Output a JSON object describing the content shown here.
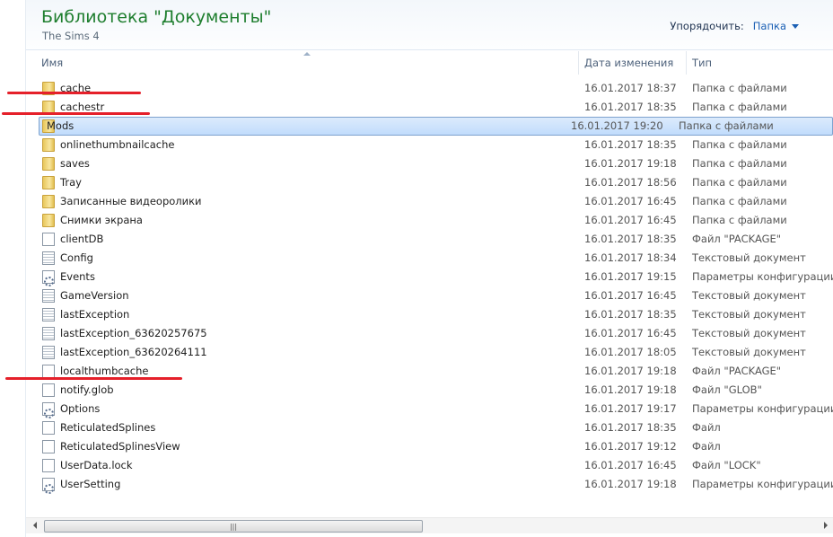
{
  "header": {
    "title": "Библиотека \"Документы\"",
    "subtitle": "The Sims 4",
    "arrange_label": "Упорядочить:",
    "arrange_value": "Папка"
  },
  "columns": {
    "name": "Имя",
    "date": "Дата изменения",
    "type": "Тип"
  },
  "rows": [
    {
      "name": "cache",
      "date": "16.01.2017 18:37",
      "type": "Папка с файлами",
      "icon": "folder"
    },
    {
      "name": "cachestr",
      "date": "16.01.2017 18:35",
      "type": "Папка с файлами",
      "icon": "folder"
    },
    {
      "name": "Mods",
      "date": "16.01.2017 19:20",
      "type": "Папка с файлами",
      "icon": "folder",
      "selected": true
    },
    {
      "name": "onlinethumbnailcache",
      "date": "16.01.2017 18:35",
      "type": "Папка с файлами",
      "icon": "folder"
    },
    {
      "name": "saves",
      "date": "16.01.2017 19:18",
      "type": "Папка с файлами",
      "icon": "folder"
    },
    {
      "name": "Tray",
      "date": "16.01.2017 18:56",
      "type": "Папка с файлами",
      "icon": "folder"
    },
    {
      "name": "Записанные видеоролики",
      "date": "16.01.2017 16:45",
      "type": "Папка с файлами",
      "icon": "folder"
    },
    {
      "name": "Снимки экрана",
      "date": "16.01.2017 16:45",
      "type": "Папка с файлами",
      "icon": "folder"
    },
    {
      "name": "clientDB",
      "date": "16.01.2017 18:35",
      "type": "Файл \"PACKAGE\"",
      "icon": "file"
    },
    {
      "name": "Config",
      "date": "16.01.2017 18:34",
      "type": "Текстовый документ",
      "icon": "txt"
    },
    {
      "name": "Events",
      "date": "16.01.2017 19:15",
      "type": "Параметры конфигурации",
      "icon": "cfg"
    },
    {
      "name": "GameVersion",
      "date": "16.01.2017 16:45",
      "type": "Текстовый документ",
      "icon": "txt"
    },
    {
      "name": "lastException",
      "date": "16.01.2017 18:35",
      "type": "Текстовый документ",
      "icon": "txt"
    },
    {
      "name": "lastException_63620257675",
      "date": "16.01.2017 16:45",
      "type": "Текстовый документ",
      "icon": "txt"
    },
    {
      "name": "lastException_63620264111",
      "date": "16.01.2017 18:05",
      "type": "Текстовый документ",
      "icon": "txt"
    },
    {
      "name": "localthumbcache",
      "date": "16.01.2017 19:18",
      "type": "Файл \"PACKAGE\"",
      "icon": "file"
    },
    {
      "name": "notify.glob",
      "date": "16.01.2017 19:18",
      "type": "Файл \"GLOB\"",
      "icon": "file"
    },
    {
      "name": "Options",
      "date": "16.01.2017 19:17",
      "type": "Параметры конфигурации",
      "icon": "cfg"
    },
    {
      "name": "ReticulatedSplines",
      "date": "16.01.2017 18:35",
      "type": "Файл",
      "icon": "file"
    },
    {
      "name": "ReticulatedSplinesView",
      "date": "16.01.2017 19:12",
      "type": "Файл",
      "icon": "file"
    },
    {
      "name": "UserData.lock",
      "date": "16.01.2017 16:45",
      "type": "Файл \"LOCK\"",
      "icon": "file"
    },
    {
      "name": "UserSetting",
      "date": "16.01.2017 19:18",
      "type": "Параметры конфигурации",
      "icon": "cfg"
    }
  ],
  "colors": {
    "title": "#1e7e2e",
    "annotation": "#e5202a",
    "selection": "#c1dcfc"
  }
}
